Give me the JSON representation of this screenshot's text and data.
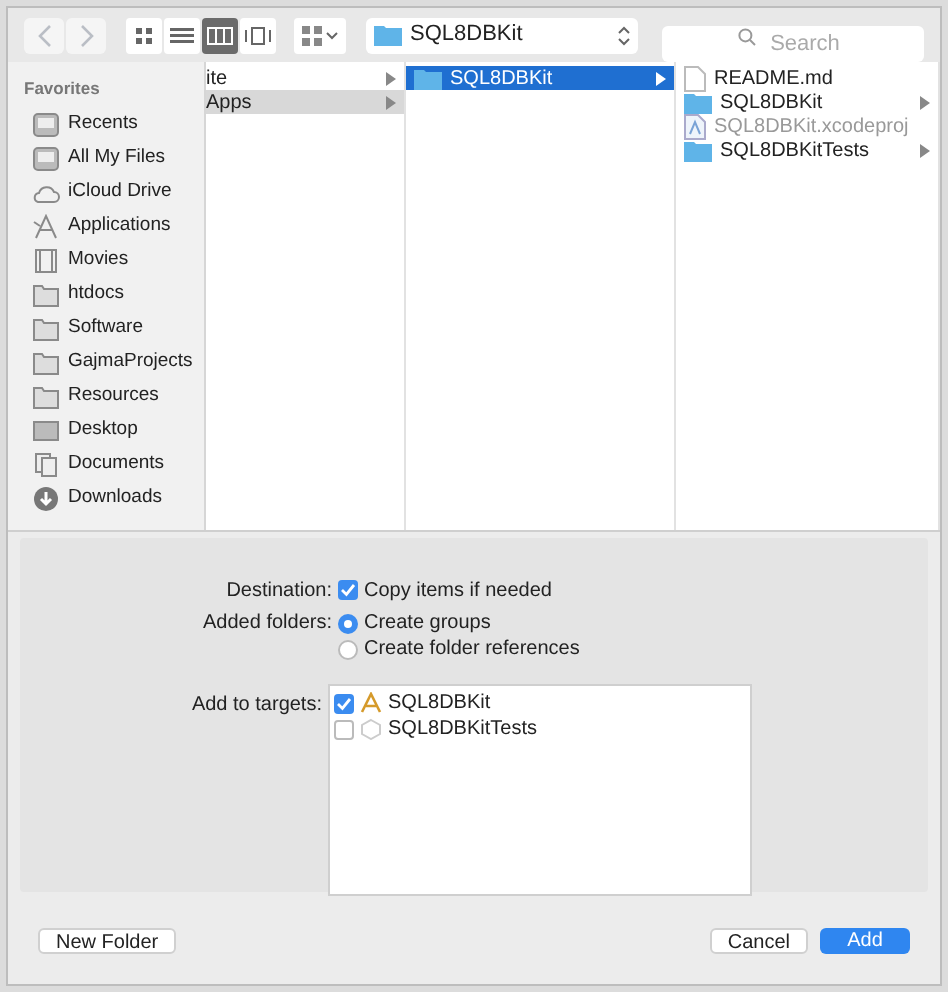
{
  "toolbar": {
    "nav": [
      {
        "kind": "back",
        "disabled": true
      },
      {
        "kind": "forward",
        "disabled": true
      }
    ],
    "views": [
      {
        "kind": "icons",
        "selected": false
      },
      {
        "kind": "list",
        "selected": false
      },
      {
        "kind": "columns",
        "selected": true
      },
      {
        "kind": "coverflow",
        "selected": false
      }
    ],
    "path": {
      "label": "SQL8DBKit"
    },
    "search": {
      "placeholder": "Search"
    }
  },
  "sidebar": {
    "heading": "Favorites",
    "items": [
      {
        "label": "Recents",
        "kind": "drive"
      },
      {
        "label": "All My Files",
        "kind": "drive"
      },
      {
        "label": "iCloud Drive",
        "kind": "cloud"
      },
      {
        "label": "Applications",
        "kind": "apps"
      },
      {
        "label": "Movies",
        "kind": "film"
      },
      {
        "label": "htdocs",
        "kind": "folder"
      },
      {
        "label": "Software",
        "kind": "folder"
      },
      {
        "label": "GajmaProjects",
        "kind": "folder"
      },
      {
        "label": "Resources",
        "kind": "folder"
      },
      {
        "label": "Desktop",
        "kind": "desktop"
      },
      {
        "label": "Documents",
        "kind": "docs"
      },
      {
        "label": "Downloads",
        "kind": "download"
      }
    ]
  },
  "columns": [
    {
      "active": false,
      "items": [
        {
          "label": "ite",
          "kind": "none",
          "selected": false,
          "has_children": true,
          "disabled": false
        },
        {
          "label": "Apps",
          "kind": "none",
          "selected": true,
          "has_children": true,
          "disabled": false
        }
      ]
    },
    {
      "active": true,
      "items": [
        {
          "label": "SQL8DBKit",
          "kind": "folder",
          "selected": true,
          "has_children": true
        }
      ]
    },
    {
      "items": [
        {
          "label": "README.md",
          "kind": "file",
          "selected": false,
          "has_children": false,
          "disabled": false
        },
        {
          "label": "SQL8DBKit",
          "kind": "folder",
          "selected": false,
          "has_children": true,
          "disabled": false
        },
        {
          "label": "SQL8DBKit.xcodeproj",
          "kind": "project",
          "selected": false,
          "has_children": false,
          "disabled": true
        },
        {
          "label": "SQL8DBKitTests",
          "kind": "folder",
          "selected": false,
          "has_children": true,
          "disabled": false
        }
      ]
    }
  ],
  "options": {
    "destination": {
      "label": "Destination:",
      "option": "Copy items if needed",
      "checked": true
    },
    "added_folders": {
      "label": "Added folders:",
      "choices": [
        {
          "label": "Create groups",
          "selected": true
        },
        {
          "label": "Create folder references",
          "selected": false
        }
      ]
    },
    "targets": {
      "label": "Add to targets:",
      "items": [
        {
          "label": "SQL8DBKit",
          "kind": "app",
          "checked": true
        },
        {
          "label": "SQL8DBKitTests",
          "kind": "tests",
          "checked": false
        }
      ]
    }
  },
  "buttons": [
    {
      "label": "New Folder",
      "kind": "plain"
    },
    {
      "label": "Cancel",
      "kind": "plain"
    },
    {
      "label": "Add",
      "kind": "default"
    }
  ]
}
